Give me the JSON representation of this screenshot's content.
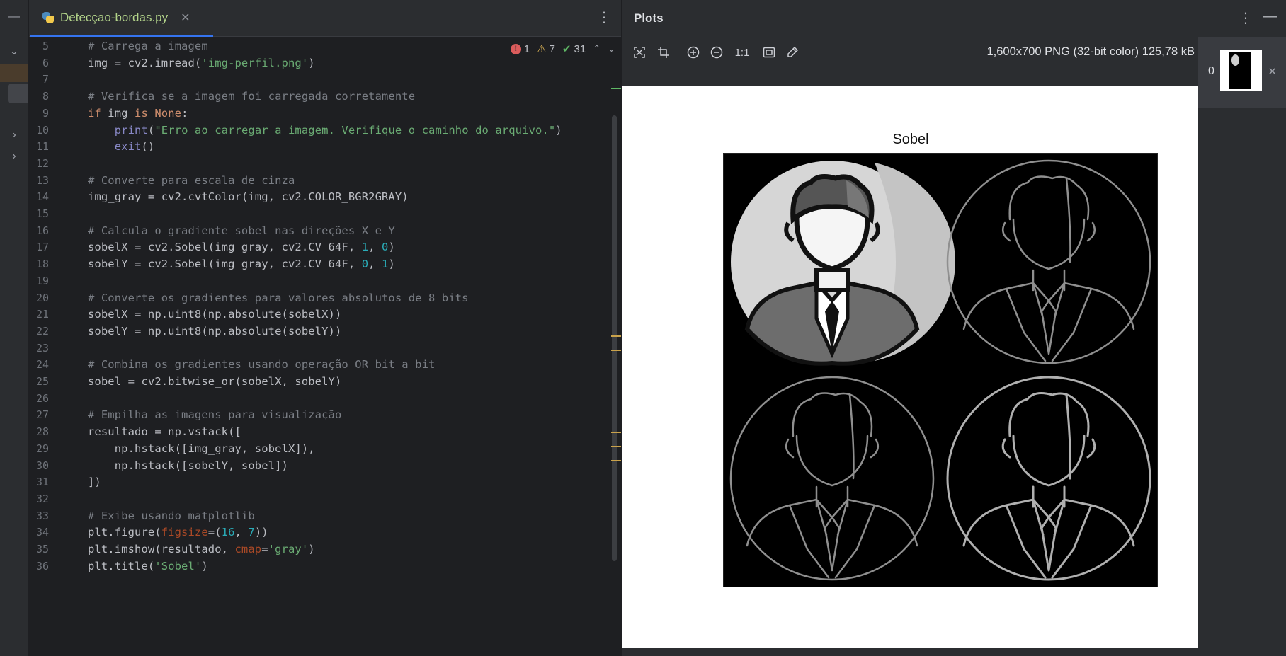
{
  "editor": {
    "tab_label": "Detecçao-bordas.py",
    "inspections": {
      "errors": "1",
      "warnings": "7",
      "ok": "31"
    },
    "lines": [
      {
        "n": "5",
        "segs": [
          [
            "cm",
            "# Carrega a imagem"
          ]
        ]
      },
      {
        "n": "6",
        "segs": [
          [
            "",
            "img = cv2.imread("
          ],
          [
            "st",
            "'img-perfil.png'"
          ],
          [
            "",
            ")"
          ]
        ]
      },
      {
        "n": "7",
        "segs": []
      },
      {
        "n": "8",
        "segs": [
          [
            "cm",
            "# Verifica se a imagem foi carregada corretamente"
          ]
        ]
      },
      {
        "n": "9",
        "segs": [
          [
            "kw",
            "if "
          ],
          [
            "",
            "img "
          ],
          [
            "kw",
            "is None"
          ],
          [
            "",
            ":"
          ]
        ]
      },
      {
        "n": "10",
        "segs": [
          [
            "",
            "    "
          ],
          [
            "bi",
            "print"
          ],
          [
            "",
            "("
          ],
          [
            "st",
            "\"Erro ao carregar a imagem. Verifique o caminho do arquivo.\""
          ],
          [
            "",
            ")"
          ]
        ]
      },
      {
        "n": "11",
        "segs": [
          [
            "",
            "    "
          ],
          [
            "bi",
            "exit"
          ],
          [
            "",
            "()"
          ]
        ]
      },
      {
        "n": "12",
        "segs": []
      },
      {
        "n": "13",
        "segs": [
          [
            "cm",
            "# Converte para escala de cinza"
          ]
        ]
      },
      {
        "n": "14",
        "segs": [
          [
            "",
            "img_gray = cv2.cvtColor(img, cv2.COLOR_BGR2GRAY)"
          ]
        ]
      },
      {
        "n": "15",
        "segs": []
      },
      {
        "n": "16",
        "segs": [
          [
            "cm",
            "# Calcula o gradiente sobel nas direções X e Y"
          ]
        ]
      },
      {
        "n": "17",
        "segs": [
          [
            "",
            "sobelX = cv2.Sobel(img_gray, cv2.CV_64F, "
          ],
          [
            "nu",
            "1"
          ],
          [
            "",
            ", "
          ],
          [
            "nu",
            "0"
          ],
          [
            "",
            ")"
          ]
        ]
      },
      {
        "n": "18",
        "segs": [
          [
            "",
            "sobelY = cv2.Sobel(img_gray, cv2.CV_64F, "
          ],
          [
            "nu",
            "0"
          ],
          [
            "",
            ", "
          ],
          [
            "nu",
            "1"
          ],
          [
            "",
            ")"
          ]
        ]
      },
      {
        "n": "19",
        "segs": []
      },
      {
        "n": "20",
        "segs": [
          [
            "cm",
            "# Converte os gradientes para valores absolutos de 8 bits"
          ]
        ]
      },
      {
        "n": "21",
        "segs": [
          [
            "",
            "sobelX = np.uint8(np.absolute(sobelX))"
          ]
        ]
      },
      {
        "n": "22",
        "segs": [
          [
            "",
            "sobelY = np.uint8(np.absolute(sobelY))"
          ]
        ]
      },
      {
        "n": "23",
        "segs": []
      },
      {
        "n": "24",
        "segs": [
          [
            "cm",
            "# Combina os gradientes usando operação OR bit a bit"
          ]
        ]
      },
      {
        "n": "25",
        "segs": [
          [
            "",
            "sobel = cv2.bitwise_or(sobelX, sobelY)"
          ]
        ]
      },
      {
        "n": "26",
        "segs": []
      },
      {
        "n": "27",
        "segs": [
          [
            "cm",
            "# Empilha as imagens para visualização"
          ]
        ]
      },
      {
        "n": "28",
        "segs": [
          [
            "",
            "resultado = np.vstack(["
          ]
        ]
      },
      {
        "n": "29",
        "segs": [
          [
            "",
            "    np.hstack([img_gray, sobelX]),"
          ]
        ]
      },
      {
        "n": "30",
        "segs": [
          [
            "",
            "    np.hstack([sobelY, sobel])"
          ]
        ]
      },
      {
        "n": "31",
        "segs": [
          [
            "",
            "])"
          ]
        ]
      },
      {
        "n": "32",
        "segs": []
      },
      {
        "n": "33",
        "segs": [
          [
            "cm",
            "# Exibe usando matplotlib"
          ]
        ]
      },
      {
        "n": "34",
        "segs": [
          [
            "",
            "plt.figure("
          ],
          [
            "pa",
            "figsize"
          ],
          [
            "",
            "=("
          ],
          [
            "nu",
            "16"
          ],
          [
            "",
            ", "
          ],
          [
            "nu",
            "7"
          ],
          [
            "",
            "))"
          ]
        ]
      },
      {
        "n": "35",
        "segs": [
          [
            "",
            "plt.imshow(resultado, "
          ],
          [
            "pa",
            "cmap"
          ],
          [
            "",
            "="
          ],
          [
            "st",
            "'gray'"
          ],
          [
            "",
            ")"
          ]
        ]
      },
      {
        "n": "36",
        "segs": [
          [
            "",
            "plt.title("
          ],
          [
            "st",
            "'Sobel'"
          ],
          [
            "",
            ")"
          ]
        ]
      }
    ]
  },
  "plots": {
    "title": "Plots",
    "image_info": "1,600x700 PNG (32-bit color) 125,78 kB",
    "zoom_label": "1:1",
    "plot_title": "Sobel",
    "thumbnail_index": "0",
    "toolbar_icons": [
      "fit-icon",
      "crop-icon",
      "zoom-in-icon",
      "zoom-out-icon",
      "actual-size-icon",
      "background-icon",
      "color-picker-icon"
    ]
  }
}
